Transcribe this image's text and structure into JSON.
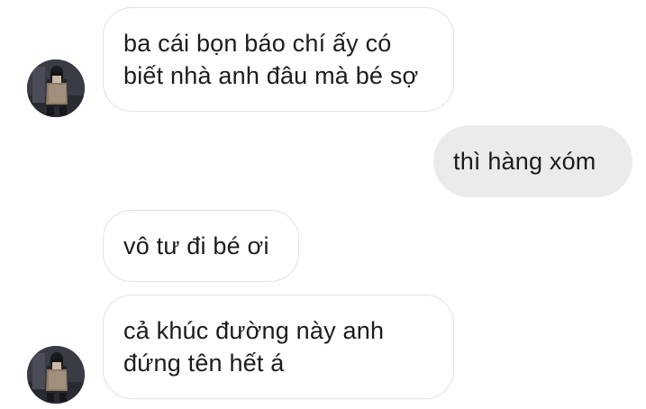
{
  "conversation": {
    "messages": [
      {
        "sender": "contact",
        "lines": [
          "ba cái bọn báo chí ấy có",
          "biết nhà anh đâu mà bé sợ"
        ]
      },
      {
        "sender": "self",
        "lines": [
          "thì hàng xóm"
        ]
      },
      {
        "sender": "contact",
        "lines": [
          "vô tư đi bé ơi"
        ]
      },
      {
        "sender": "contact",
        "lines": [
          "cả khúc đường này anh",
          "đứng tên hết á"
        ]
      }
    ]
  },
  "colors": {
    "incoming_bubble": "#ffffff",
    "incoming_border": "#e3e3e3",
    "outgoing_bubble": "#ebebeb",
    "text": "#1c1c1c"
  },
  "icons": {
    "avatar": "contact-avatar-photo"
  }
}
